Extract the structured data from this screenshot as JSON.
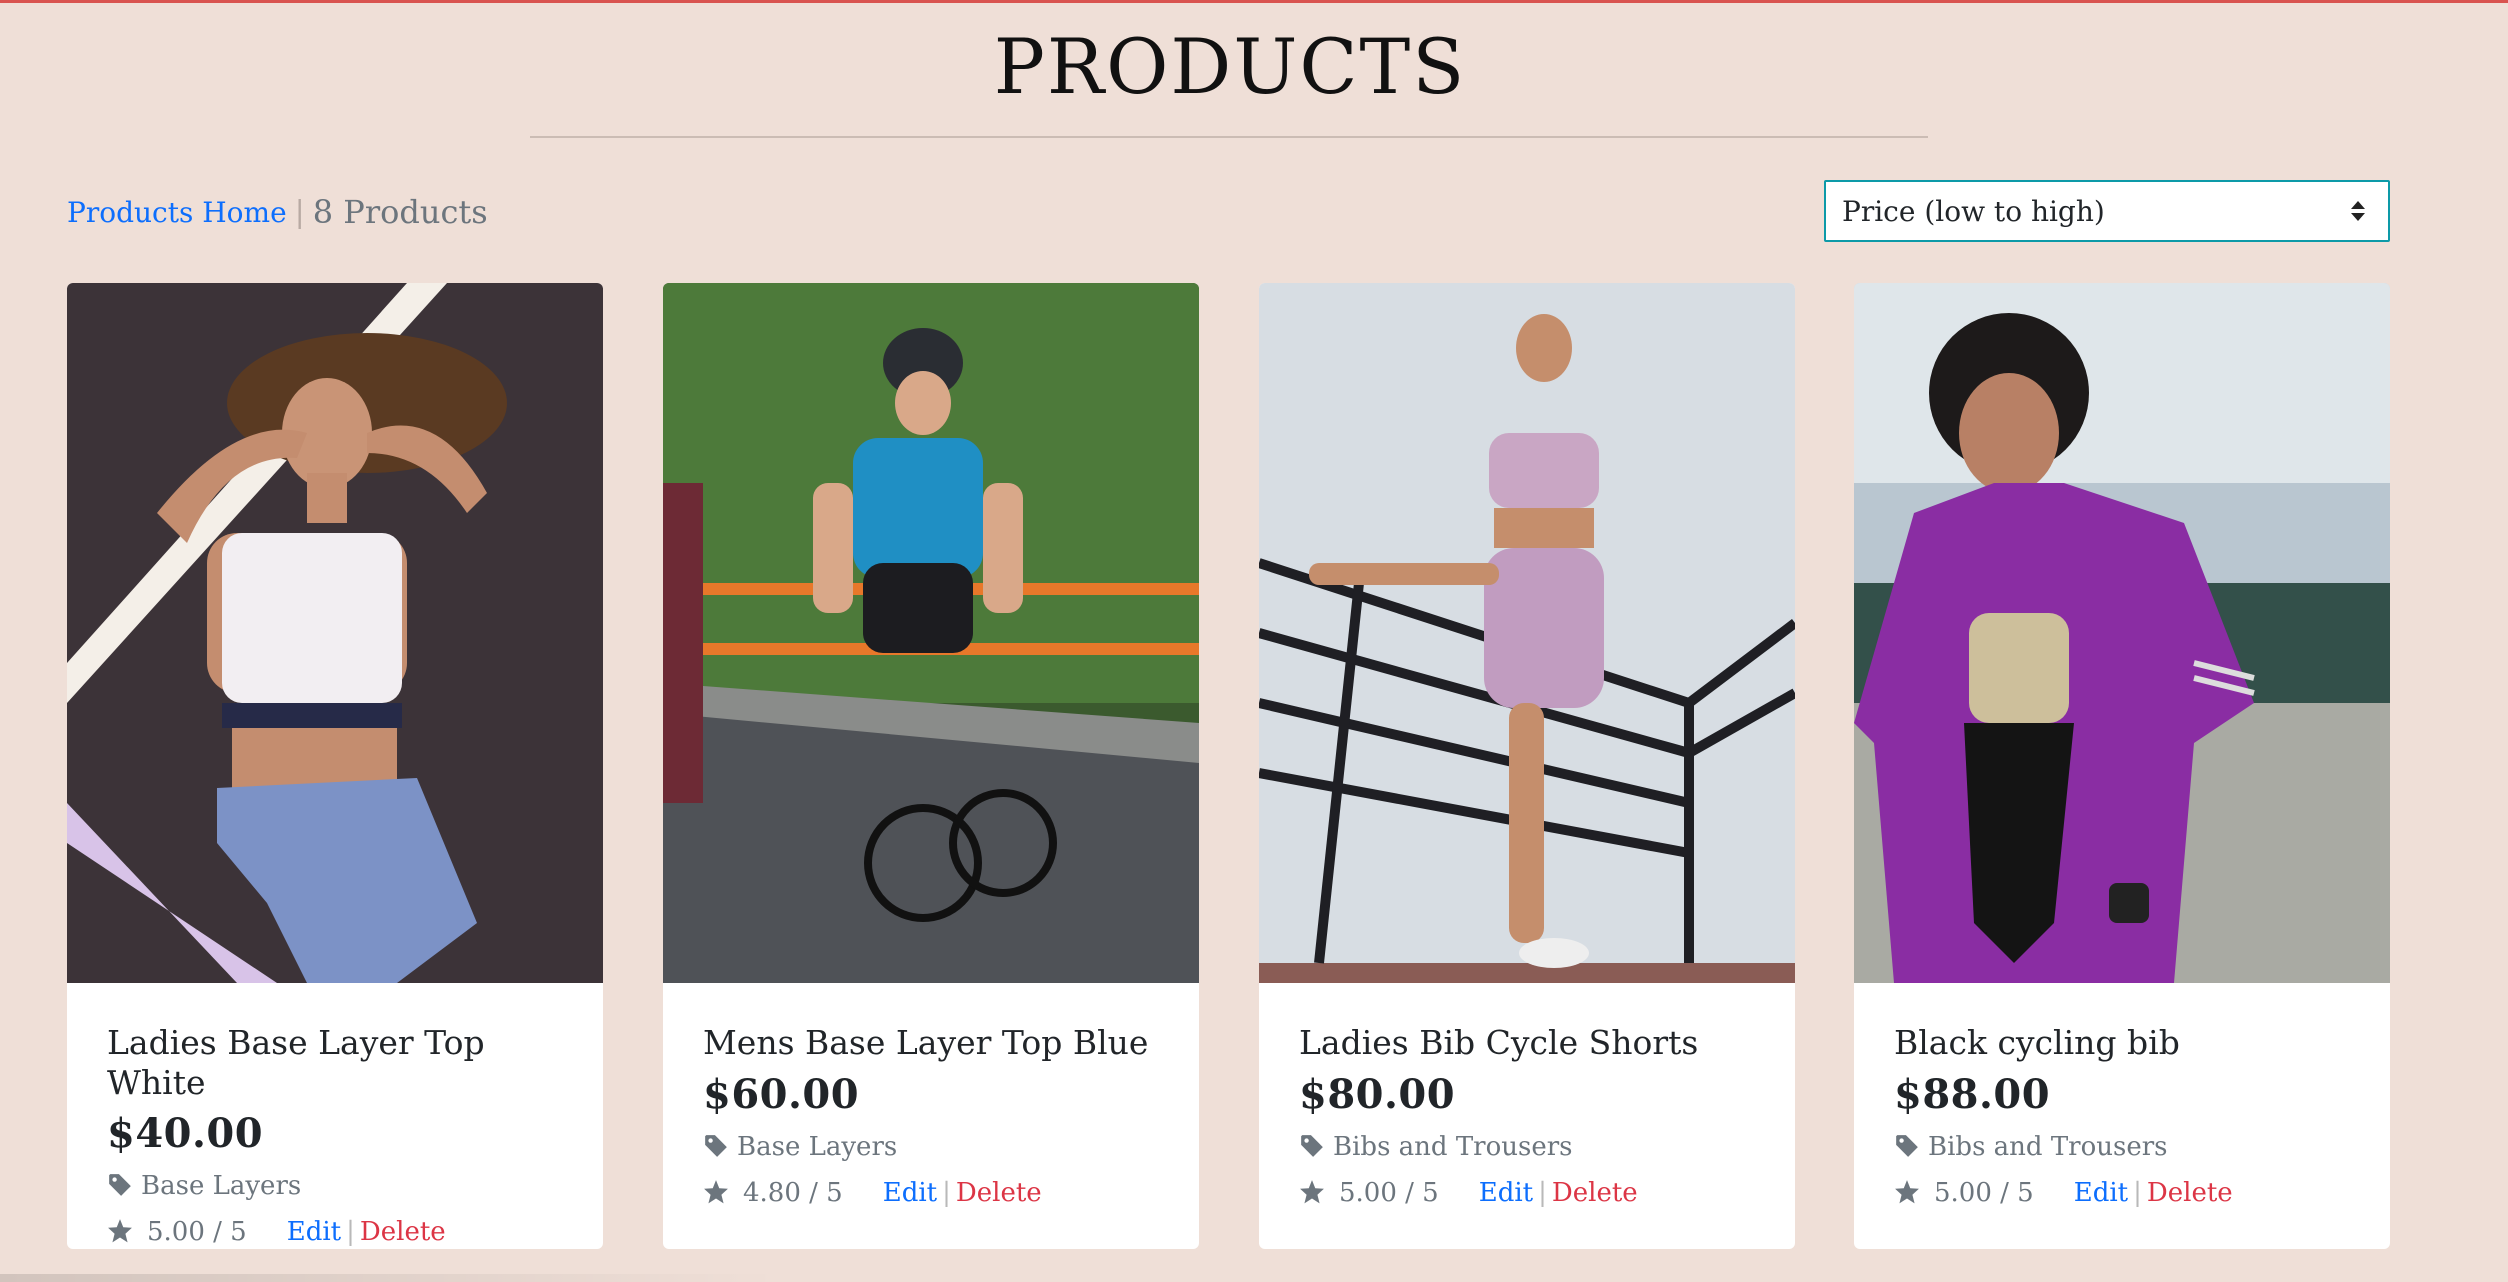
{
  "page": {
    "title": "PRODUCTS"
  },
  "toolbar": {
    "home_link": "Products Home",
    "separator": "|",
    "count_text": "8 Products"
  },
  "sort": {
    "selected": "Price (low to high)"
  },
  "products": [
    {
      "name": "Ladies Base Layer Top White",
      "price": "$40.00",
      "category": "Base Layers",
      "rating": "5.00 / 5",
      "edit": "Edit",
      "delete": "Delete",
      "sep": "|"
    },
    {
      "name": "Mens Base Layer Top Blue",
      "price": "$60.00",
      "category": "Base Layers",
      "rating": "4.80 / 5",
      "edit": "Edit",
      "delete": "Delete",
      "sep": "|"
    },
    {
      "name": "Ladies Bib Cycle Shorts",
      "price": "$80.00",
      "category": "Bibs and Trousers",
      "rating": "5.00 / 5",
      "edit": "Edit",
      "delete": "Delete",
      "sep": "|"
    },
    {
      "name": "Black cycling bib",
      "price": "$88.00",
      "category": "Bibs and Trousers",
      "rating": "5.00 / 5",
      "edit": "Edit",
      "delete": "Delete",
      "sep": "|"
    }
  ],
  "colors": {
    "background": "#efdfd7",
    "link": "#0d6efd",
    "delete": "#dc3545",
    "select_border": "#0d9aa8",
    "muted": "#6c757d"
  },
  "icons": [
    "tag-icon",
    "star-icon",
    "sort-arrows-icon"
  ]
}
